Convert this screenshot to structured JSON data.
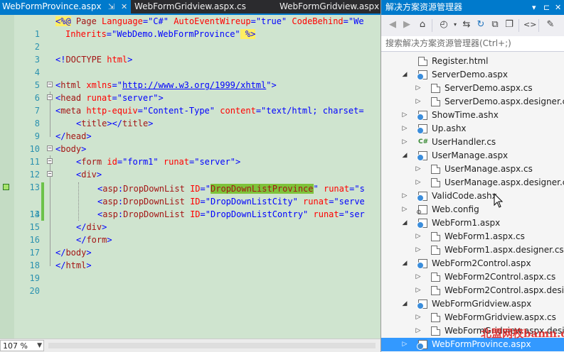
{
  "editor": {
    "tabs": [
      {
        "label": "WebFormProvince.aspx",
        "active": true,
        "pin": "⇲",
        "close": "✕"
      },
      {
        "label": "WebFormGridview.aspx.cs",
        "active": false
      },
      {
        "label": "WebFormGridview.aspx",
        "active": false
      }
    ],
    "line_numbers": [
      "1",
      "2",
      "3",
      "4",
      "5",
      "6",
      "7",
      "8",
      "9",
      "10",
      "11",
      "12",
      "13",
      "14",
      "15",
      "16",
      "17",
      "18",
      "19",
      "20"
    ],
    "code": {
      "l1": {
        "a": "<%@",
        "b": " Page ",
        "c": "Language",
        "d": "=",
        "e": "\"C#\"",
        "f": " AutoEventWireup",
        "g": "=",
        "h": "\"true\"",
        "i": " CodeBehind",
        "j": "=",
        "k": "\"We"
      },
      "l2": {
        "a": "Inherits",
        "b": "=",
        "c": "\"WebDemo.WebFormProvince\"",
        "d": " %>"
      },
      "l4": {
        "a": "<!",
        "b": "DOCTYPE",
        "c": " html",
        "d": ">"
      },
      "l6": {
        "a": "<",
        "b": "html",
        "c": " xmlns",
        "d": "=",
        "e": "\"",
        "f": "http://www.w3.org/1999/xhtml",
        "g": "\"",
        "h": ">"
      },
      "l7": {
        "a": "<",
        "b": "head",
        "c": " runat",
        "d": "=",
        "e": "\"server\"",
        "f": ">"
      },
      "l8": {
        "a": "<",
        "b": "meta",
        "c": " http-equiv",
        "d": "=",
        "e": "\"Content-Type\"",
        "f": " content",
        "g": "=",
        "h": "\"text/html; charset="
      },
      "l9": {
        "a": "<",
        "b": "title",
        "c": "></",
        "d": "title",
        "e": ">"
      },
      "l10": {
        "a": "</",
        "b": "head",
        "c": ">"
      },
      "l11": {
        "a": "<",
        "b": "body",
        "c": ">"
      },
      "l12": {
        "a": "<",
        "b": "form",
        "c": " id",
        "d": "=",
        "e": "\"form1\"",
        "f": " runat",
        "g": "=",
        "h": "\"server\"",
        "i": ">"
      },
      "l13": {
        "a": "<",
        "b": "div",
        "c": ">"
      },
      "l14": {
        "a": "<",
        "b": "asp",
        "c": ":",
        "d": "DropDownList",
        "e": " ID",
        "f": "=",
        "g": "\"",
        "h": "DropDownListProvince",
        "i": "\"",
        "j": " runat",
        "k": "=",
        "l": "\"s"
      },
      "l15": {
        "a": "<",
        "b": "asp",
        "c": ":",
        "d": "DropDownList",
        "e": " ID",
        "f": "=",
        "g": "\"DropDownListCity\"",
        "h": " runat",
        "i": "=",
        "j": "\"serve"
      },
      "l16": {
        "a": "<",
        "b": "asp",
        "c": ":",
        "d": "DropDownList",
        "e": " ID",
        "f": "=",
        "g": "\"DropDownListContry\"",
        "h": " runat",
        "i": "=",
        "j": "\"ser"
      },
      "l17": {
        "a": "</",
        "b": "div",
        "c": ">"
      },
      "l18": {
        "a": "</",
        "b": "form",
        "c": ">"
      },
      "l19": {
        "a": "</",
        "b": "body",
        "c": ">"
      },
      "l20": {
        "a": "</",
        "b": "html",
        "c": ">"
      }
    },
    "zoom": "107 %"
  },
  "solution_explorer": {
    "title": "解决方案资源管理器",
    "title_buttons": [
      "▾",
      "⊏",
      "✕"
    ],
    "toolbar_icons": [
      "back-icon",
      "forward-icon",
      "home-icon",
      "history-icon",
      "sync-icon",
      "refresh-icon",
      "collapse-icon",
      "show-all-icon",
      "view-code-icon",
      "properties-icon"
    ],
    "search_placeholder": "搜索解决方案资源管理器(Ctrl+;)",
    "items": [
      {
        "label": "Register.html",
        "icon": "page",
        "expander": ""
      },
      {
        "label": "ServerDemo.aspx",
        "icon": "web",
        "expander": "◢"
      },
      {
        "label": "ServerDemo.aspx.cs",
        "icon": "page",
        "expander": "▷"
      },
      {
        "label": "ServerDemo.aspx.designer.cs",
        "icon": "page",
        "expander": "▷"
      },
      {
        "label": "ShowTime.ashx",
        "icon": "web",
        "expander": "▷"
      },
      {
        "label": "Up.ashx",
        "icon": "web",
        "expander": "▷"
      },
      {
        "label": "UserHandler.cs",
        "icon": "cs",
        "expander": "▷"
      },
      {
        "label": "UserManage.aspx",
        "icon": "web",
        "expander": "◢"
      },
      {
        "label": "UserManage.aspx.cs",
        "icon": "page",
        "expander": "▷"
      },
      {
        "label": "UserManage.aspx.designer.cs",
        "icon": "page",
        "expander": "▷"
      },
      {
        "label": "ValidCode.ashx",
        "icon": "web",
        "expander": "▷"
      },
      {
        "label": "Web.config",
        "icon": "cfg",
        "expander": "▷"
      },
      {
        "label": "WebForm1.aspx",
        "icon": "web",
        "expander": "◢"
      },
      {
        "label": "WebForm1.aspx.cs",
        "icon": "page",
        "expander": "▷"
      },
      {
        "label": "WebForm1.aspx.designer.cs",
        "icon": "page",
        "expander": "▷"
      },
      {
        "label": "WebForm2Control.aspx",
        "icon": "web",
        "expander": "◢"
      },
      {
        "label": "WebForm2Control.aspx.cs",
        "icon": "page",
        "expander": "▷"
      },
      {
        "label": "WebForm2Control.aspx.desig",
        "icon": "page",
        "expander": "▷"
      },
      {
        "label": "WebFormGridview.aspx",
        "icon": "web",
        "expander": "◢"
      },
      {
        "label": "WebFormGridview.aspx.cs",
        "icon": "page",
        "expander": "▷"
      },
      {
        "label": "WebFormGridview.aspx.desig",
        "icon": "page",
        "expander": "▷"
      },
      {
        "label": "WebFormProvince.aspx",
        "icon": "web",
        "expander": "▷",
        "selected": true
      }
    ]
  },
  "watermark": "北盟网校bamn.cn"
}
